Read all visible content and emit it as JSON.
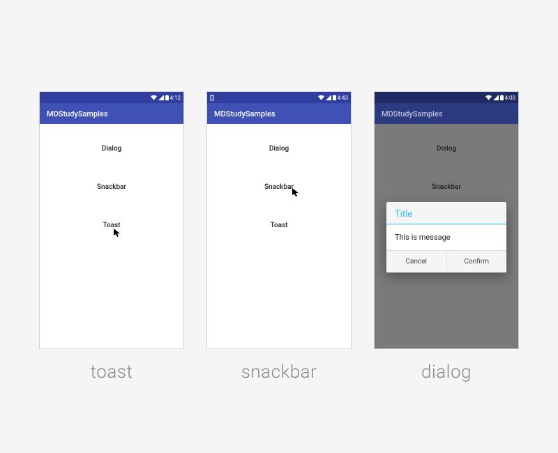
{
  "captions": {
    "toast": "toast",
    "snackbar": "snackbar",
    "dialog": "dialog"
  },
  "app": {
    "title": "MDStudySamples"
  },
  "menu": {
    "dialog": "Dialog",
    "snackbar": "Snackbar",
    "toast": "Toast"
  },
  "status": {
    "time_toast": "4:12",
    "time_snackbar": "4:43",
    "time_dialog": "4:00"
  },
  "dialog": {
    "title": "Title",
    "message": "This is message",
    "cancel": "Cancel",
    "confirm": "Confirm"
  },
  "colors": {
    "primary": "#3f51b5",
    "primary_dark": "#303f9f",
    "accent": "#29b6f6"
  }
}
